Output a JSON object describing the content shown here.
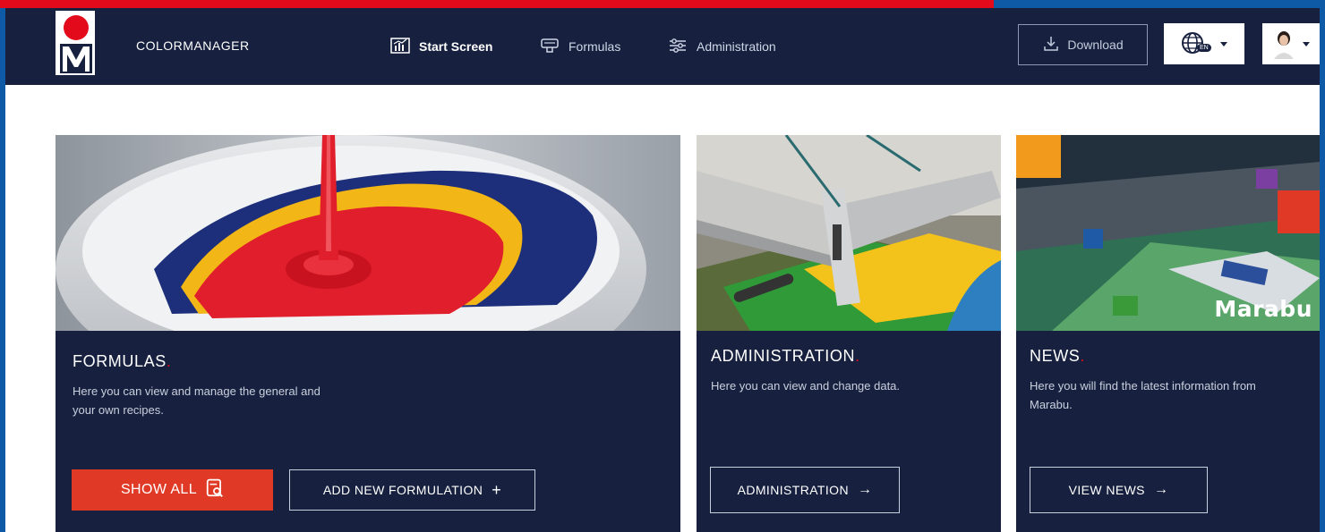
{
  "header": {
    "app_title": "COLORMANAGER",
    "nav": [
      {
        "label": "Start Screen",
        "icon": "chart-icon",
        "active": true
      },
      {
        "label": "Formulas",
        "icon": "paint-tray-icon",
        "active": false
      },
      {
        "label": "Administration",
        "icon": "sliders-icon",
        "active": false
      }
    ],
    "download_label": "Download",
    "language_code": "EN"
  },
  "cards": [
    {
      "title": "FORMULAS",
      "title_suffix": ".",
      "description_line1": "Here you can view and manage the general and",
      "description_line2": "your own recipes.",
      "primary_button": "SHOW ALL",
      "secondary_button": "ADD NEW FORMULATION",
      "secondary_icon": "+"
    },
    {
      "title": "ADMINISTRATION",
      "title_suffix": ".",
      "description_line1": "Here you can view and change data.",
      "button": "ADMINISTRATION",
      "button_icon": "→"
    },
    {
      "title": "NEWS",
      "title_suffix": ".",
      "description_line1": "Here you will find the latest information from",
      "description_line2": "Marabu.",
      "button": "VIEW NEWS",
      "button_icon": "→",
      "image_brand": "Marabu"
    }
  ],
  "colors": {
    "navy": "#17213f",
    "red": "#e30a1b",
    "button_red": "#e03a27",
    "frame_blue": "#0f5aa6"
  }
}
